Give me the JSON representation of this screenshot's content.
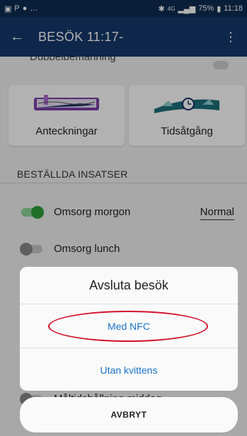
{
  "status_bar": {
    "left_text": "…",
    "network": "4G",
    "battery": "75%",
    "time": "11:18"
  },
  "app_bar": {
    "back_icon": "arrow-back-icon",
    "title": "BESÖK 11:17-",
    "menu_icon": "more-vert-icon"
  },
  "partial_row": {
    "label": "Dubbelbemanning"
  },
  "tiles": [
    {
      "label": "Anteckningar",
      "icon": "notebook-pen-icon"
    },
    {
      "label": "Tidsåtgång",
      "icon": "clock-leaves-icon"
    }
  ],
  "section": {
    "title": "BESTÄLLDA INSATSER"
  },
  "services": [
    {
      "name": "Omsorg morgon",
      "level": "Normal",
      "enabled": true
    },
    {
      "name": "Omsorg lunch",
      "level": "",
      "enabled": false
    },
    {
      "name": "Måltidshållning middag",
      "level": "",
      "enabled": false
    }
  ],
  "dialog": {
    "title": "Avsluta besök",
    "options": [
      {
        "label": "Med NFC",
        "highlighted": true
      },
      {
        "label": "Utan kvittens",
        "highlighted": false
      }
    ],
    "cancel_label": "AVBRYT"
  },
  "colors": {
    "primary": "#15386a",
    "status_bar": "#0e2d52",
    "switch_on": "#2e9e3a",
    "link": "#1a73c4",
    "highlight_ring": "#d0142b"
  }
}
